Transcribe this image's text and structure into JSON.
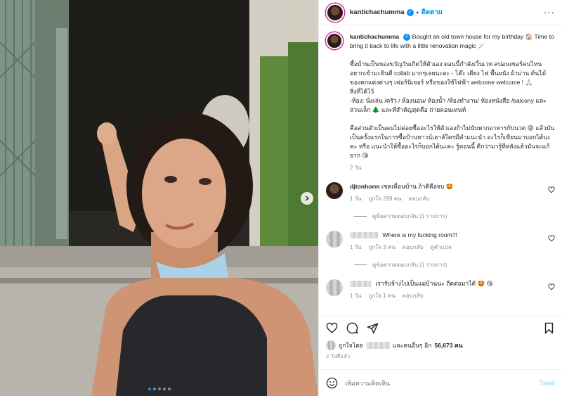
{
  "header": {
    "username": "kantichachumma",
    "separator": "•",
    "follow_label": "ติดตาม",
    "more_label": "···"
  },
  "caption": {
    "username": "kantichachumma",
    "line1": "Bought an old town house for my birthday 🏠 Time to bring it back to life with a little renovation magic 🪄",
    "para1": "ซื้อบ้านเป็นของขวัญวันเกิดให้ตัวเอง ตอนนี้กำลังเวิ้นเวท สปอนเซอร์คนไหนอยากเข้ามะยินดี collab มากๆเลยนะคะ - โต๊ะ เตียง ไฟ พื้นผนัง ผ้าม่าน ต้นไม้ ของตกแต่งต่างๆ เฟอร์นิเจอร์ หรือของใช้ไฟฟ้า welcome welcome ! 🙏🏻",
    "para2": "สิ่งที่ได้ไว้\n-ห้อง: นั่งเล่น /ครัว / ห้องนอน/ ห้องน้ำ /ห้องทำงาน/ ห้องหนังสือ /balcony และสวนเล็ก 🌲 และที่สำคัญสุดคือ ถ่ายคอนเทนท์",
    "para3": "คือส่วนตัวเป็นคนไม่ค่อยซื้ออะไรให้ตัวเองถ้าไม่นับพวกอาหารกับนวด 😝 แล้วมันเป็นครั้งแรกในการซื้อบ้านทาวน์เฮาส์ใครมีคำแนะนำ อะไรก็เขียนมาบอกได้นะคะ หรือ แนะนำให้ซื้ออะไรก็บอกได้นะคะ รู้ตอนนี้ ดีกว่ามารู้ทีหลังแล้วมันจะแก้ยาก 😘",
    "time": "2 วัน"
  },
  "comments": [
    {
      "username": "djtonhorm",
      "text": "เซดเพื่อนบ้าน ถ้าดีคือจบ 🤩",
      "time": "1 วัน",
      "likes": "ถูกใจ 299 คน",
      "reply": "ตอบกลับ",
      "translate": "",
      "replies_label": "ดูข้อความตอบกลับ (1 รายการ)"
    },
    {
      "username": "",
      "text": "Where is my fucking room?!",
      "time": "1 วัน",
      "likes": "ถูกใจ 3 คน",
      "reply": "ตอบกลับ",
      "translate": "ดูคำแปล",
      "replies_label": "ดูข้อความตอบกลับ (1 รายการ)"
    },
    {
      "username": "",
      "text": "เรารับจ้างไปเป็นแม่บ้านนะ ถีดต่อมาได้ 🤩 😘",
      "time": "1 วัน",
      "likes": "ถูกใจ 1 คน",
      "reply": "ตอบกลับ",
      "translate": "",
      "replies_label": ""
    }
  ],
  "likes": {
    "prefix": "ถูกใจโดย",
    "middle": "และคนอื่นๆ อีก",
    "count": "56,673 คน"
  },
  "posted_time": "2 วันที่แล้ว",
  "add_comment": {
    "placeholder": "เพิ่มความคิดเห็น",
    "post_label": "โพสต์"
  },
  "carousel": {
    "total": 5,
    "active": 0
  },
  "colors": {
    "accent": "#0095f6",
    "muted": "#8e8e8e",
    "text": "#262626"
  }
}
